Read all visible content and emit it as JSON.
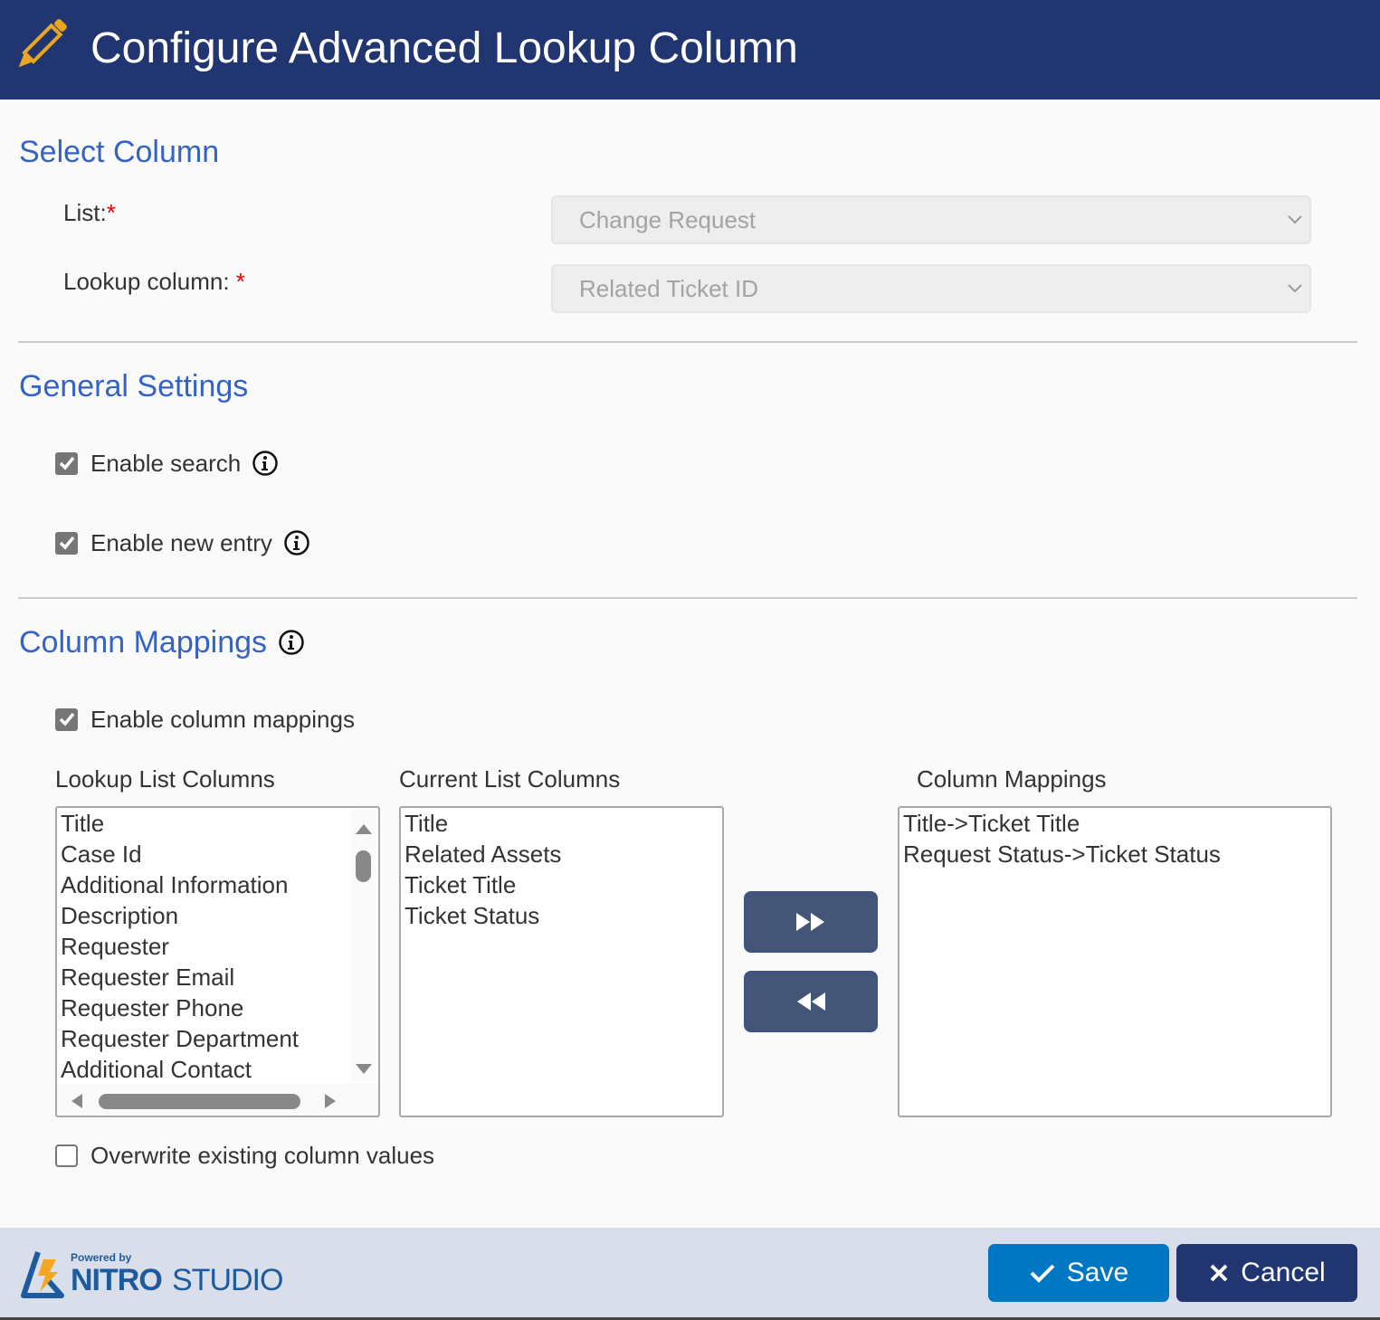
{
  "header": {
    "title": "Configure Advanced Lookup Column",
    "icon": "pencil-icon"
  },
  "select_column": {
    "section_title": "Select Column",
    "list_label": "List:",
    "list_required": "*",
    "list_value": "Change Request",
    "lookup_label": "Lookup column: ",
    "lookup_required": "*",
    "lookup_value": "Related Ticket ID"
  },
  "general_settings": {
    "section_title": "General Settings",
    "enable_search": {
      "label": "Enable search",
      "checked": true
    },
    "enable_new_entry": {
      "label": "Enable new entry",
      "checked": true
    }
  },
  "column_mappings": {
    "section_title": "Column Mappings",
    "enable_mappings": {
      "label": "Enable column mappings",
      "checked": true
    },
    "lookup_list_header": "Lookup List Columns",
    "current_list_header": "Current List Columns",
    "mappings_header": "Column Mappings",
    "lookup_list_items": [
      "Title",
      "Case Id",
      "Additional Information",
      "Description",
      "Requester",
      "Requester Email",
      "Requester Phone",
      "Requester Department",
      "Additional Contact"
    ],
    "current_list_items": [
      "Title",
      "Related Assets",
      "Ticket Title",
      "Ticket Status"
    ],
    "mapping_items": [
      "Title->Ticket Title",
      "Request Status->Ticket Status"
    ],
    "add_button_icon": "fast-forward-icon",
    "remove_button_icon": "rewind-icon",
    "overwrite": {
      "label": "Overwrite existing column values",
      "checked": false
    }
  },
  "footer": {
    "powered_by": "Powered by",
    "brand_nitro": "NITRO",
    "brand_studio": "STUDIO",
    "save_label": "Save",
    "cancel_label": "Cancel"
  },
  "colors": {
    "header_bg": "#213670",
    "section_title": "#3563c4",
    "save_bg": "#0077c3",
    "cancel_bg": "#213670",
    "move_button_bg": "#455578",
    "footer_bg": "#d9dfea",
    "pencil": "#e8a623"
  }
}
